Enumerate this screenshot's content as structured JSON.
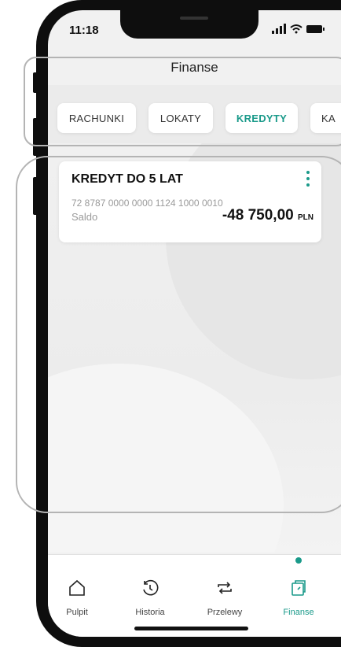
{
  "status": {
    "time": "11:18"
  },
  "header": {
    "title": "Finanse"
  },
  "tabs": [
    {
      "label": "RACHUNKI",
      "active": false
    },
    {
      "label": "LOKATY",
      "active": false
    },
    {
      "label": "KREDYTY",
      "active": true
    },
    {
      "label": "KA",
      "active": false
    }
  ],
  "account_card": {
    "title": "KREDYT DO 5 LAT",
    "number": "72 8787 0000 0000 1124 1000 0010",
    "balance_label": "Saldo",
    "balance_value": "-48 750,00",
    "currency": "PLN"
  },
  "bottom_nav": [
    {
      "label": "Pulpit",
      "icon": "home-icon",
      "active": false
    },
    {
      "label": "Historia",
      "icon": "history-icon",
      "active": false
    },
    {
      "label": "Przelewy",
      "icon": "transfer-icon",
      "active": false
    },
    {
      "label": "Finanse",
      "icon": "finance-icon",
      "active": true
    }
  ],
  "colors": {
    "accent": "#1a9a8a",
    "background": "#f1f1f1",
    "card": "#ffffff"
  }
}
